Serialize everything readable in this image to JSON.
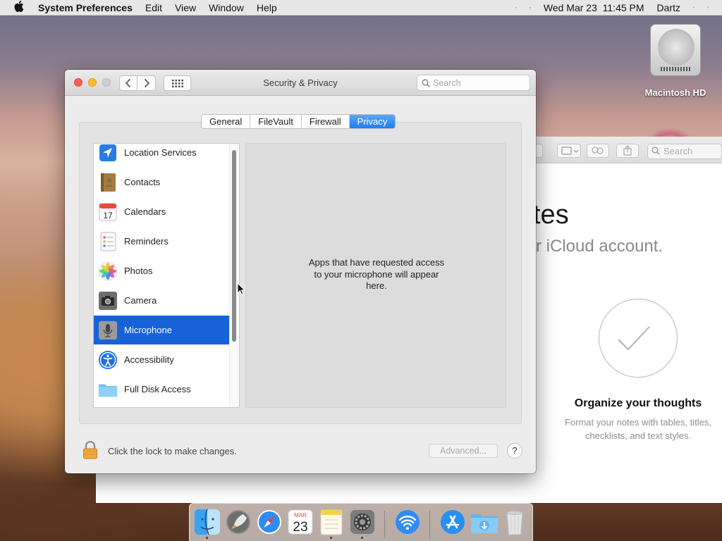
{
  "menubar": {
    "app_name": "System Preferences",
    "menus": [
      "Edit",
      "View",
      "Window",
      "Help"
    ],
    "datetime": "Wed Mar 23  11:45 PM",
    "user": "Dartz"
  },
  "desktop": {
    "hd_label": "Macintosh HD"
  },
  "notes_window": {
    "search_placeholder": "Search",
    "heading_fragment": "tes",
    "sub_fragment": "r iCloud account.",
    "organize_title": "Organize your thoughts",
    "organize_desc": "Format your notes with tables, titles, checklists, and text styles."
  },
  "window": {
    "title": "Security & Privacy",
    "search_placeholder": "Search",
    "tabs": [
      {
        "label": "General"
      },
      {
        "label": "FileVault"
      },
      {
        "label": "Firewall"
      },
      {
        "label": "Privacy"
      }
    ],
    "active_tab": "Privacy",
    "list_items": [
      {
        "label": "Location Services",
        "icon": "location-arrow-icon"
      },
      {
        "label": "Contacts",
        "icon": "contacts-book-icon"
      },
      {
        "label": "Calendars",
        "icon": "calendar-icon",
        "icon_text": "17"
      },
      {
        "label": "Reminders",
        "icon": "reminders-list-icon"
      },
      {
        "label": "Photos",
        "icon": "photos-flower-icon"
      },
      {
        "label": "Camera",
        "icon": "camera-icon"
      },
      {
        "label": "Microphone",
        "icon": "microphone-icon"
      },
      {
        "label": "Accessibility",
        "icon": "accessibility-icon"
      },
      {
        "label": "Full Disk Access",
        "icon": "folder-icon"
      }
    ],
    "selected_item": "Microphone",
    "detail_message": "Apps that have requested access to your microphone will appear here.",
    "lock_text": "Click the lock to make changes.",
    "advanced_label": "Advanced...",
    "help_label": "?"
  },
  "dock": {
    "items": [
      "finder-icon",
      "launchpad-icon",
      "safari-icon",
      "calendar-icon",
      "notes-icon",
      "system-preferences-icon",
      "wifi-diagnostics-icon",
      "app-store-icon",
      "downloads-folder-icon",
      "trash-icon"
    ],
    "calendar_month": "MAR",
    "calendar_day": "23"
  },
  "colors": {
    "accent": "#1662d8",
    "tab_active": "#2e86f5"
  }
}
